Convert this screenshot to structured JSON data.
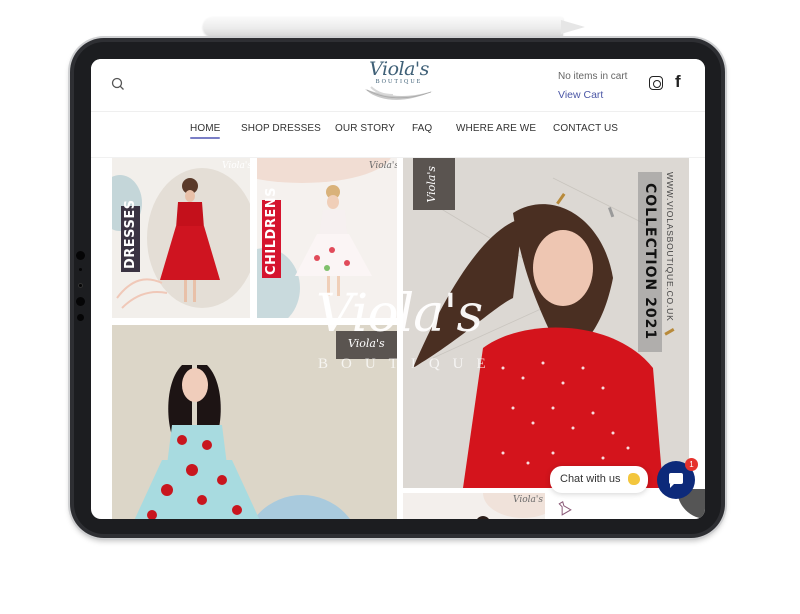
{
  "device": {
    "name": "tablet-mockup",
    "stylus": "pencil"
  },
  "header": {
    "logo": {
      "script": "Viola's",
      "subtitle": "BOUTIQUE"
    },
    "cart_status": "No items in cart",
    "view_cart_label": "View Cart",
    "icons": [
      "search-icon",
      "instagram-icon",
      "facebook-icon"
    ],
    "facebook_glyph": "f"
  },
  "nav": {
    "items": [
      {
        "label": "HOME",
        "active": true
      },
      {
        "label": "SHOP DRESSES",
        "active": false
      },
      {
        "label": "OUR STORY",
        "active": false
      },
      {
        "label": "FAQ",
        "active": false
      },
      {
        "label": "WHERE ARE WE",
        "active": false
      },
      {
        "label": "CONTACT US",
        "active": false
      }
    ],
    "active_color": "#7a7ec6"
  },
  "tiles": {
    "dresses": {
      "label": "DRESSES",
      "logo": "Viola's",
      "label_bg": "#3a3342"
    },
    "children": {
      "label": "CHILDRENS",
      "logo": "Viola's",
      "label_bg": "#d5142e"
    },
    "collection": {
      "logo": "Viola's",
      "title": "COLLECTION 2021",
      "website": "WWW.VIOLASBOUTIQUE.CO.UK"
    },
    "rose": {
      "logo": "Viola's",
      "overlay_script": "Viola's",
      "overlay_subtitle": "BOUTIQUE"
    },
    "small": {
      "logo": "Viola's"
    }
  },
  "chat": {
    "label": "Chat with us",
    "badge_count": "1",
    "button_color": "#0d2a7a"
  },
  "colors": {
    "brand": "#3f6077",
    "link": "#4b57a6",
    "badge": "#e5322d"
  }
}
